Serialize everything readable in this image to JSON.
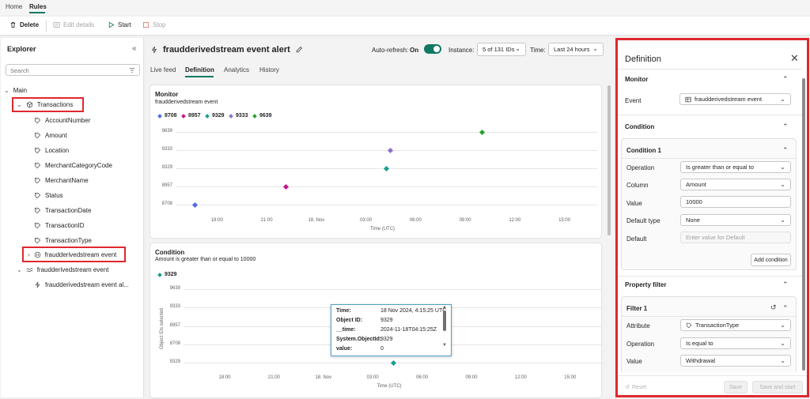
{
  "top_tabs": [
    "Home",
    "Rules"
  ],
  "toolbar": {
    "delete": "Delete",
    "edit_details": "Edit details",
    "start": "Start",
    "stop": "Stop"
  },
  "explorer": {
    "title": "Explorer",
    "search_placeholder": "Search",
    "root": "Main",
    "object": "Transactions",
    "properties": [
      "AccountNumber",
      "Amount",
      "Location",
      "MerchantCategoryCode",
      "MerchantName",
      "Status",
      "TransactionDate",
      "TransactionID",
      "TransactionType"
    ],
    "event": "fraudderivedstream event",
    "stream": "fraudderivedstream event",
    "rule": "fraudderivedstream event al..."
  },
  "rule": {
    "title": "fraudderivedstream event alert",
    "auto_refresh_label": "Auto-refresh:",
    "auto_refresh_state": "On",
    "instance_label": "Instance:",
    "instance_value": "5 of 131 IDs",
    "time_label": "Time:",
    "time_value": "Last 24 hours"
  },
  "subtabs": [
    "Live feed",
    "Definition",
    "Analytics",
    "History"
  ],
  "monitor_card": {
    "title": "Monitor",
    "subtitle": "fraudderivedstream event",
    "xlabel": "Time (UTC)"
  },
  "condition_card": {
    "title": "Condition",
    "subtitle": "Amount is greater than or equal to 10000",
    "xlabel": "Time (UTC)",
    "ylabel": "Object IDs selected"
  },
  "chart_data": [
    {
      "type": "scatter",
      "title": "Monitor",
      "subtitle": "fraudderivedstream event",
      "xlabel": "Time (UTC)",
      "x_ticks": [
        "18:00",
        "21:00",
        "18. Nov",
        "03:00",
        "06:00",
        "09:00",
        "12:00",
        "15:00"
      ],
      "y_categories": [
        "9639",
        "9333",
        "9329",
        "8957",
        "8708"
      ],
      "series": [
        {
          "name": "8708",
          "color": "#4f6bed",
          "points": [
            {
              "x": "17 Nov 16:40",
              "y": "8708"
            }
          ]
        },
        {
          "name": "8957",
          "color": "#c4168f",
          "points": [
            {
              "x": "17 Nov 22:10",
              "y": "8957"
            }
          ]
        },
        {
          "name": "9329",
          "color": "#1a9e8f",
          "points": [
            {
              "x": "18 Nov 04:15",
              "y": "9329"
            }
          ]
        },
        {
          "name": "9333",
          "color": "#8b6fd0",
          "points": [
            {
              "x": "18 Nov 04:30",
              "y": "9333"
            }
          ]
        },
        {
          "name": "9639",
          "color": "#2aa12f",
          "points": [
            {
              "x": "18 Nov 10:00",
              "y": "9639"
            }
          ]
        }
      ]
    },
    {
      "type": "scatter",
      "title": "Condition",
      "subtitle": "Amount is greater than or equal to 10000",
      "xlabel": "Time (UTC)",
      "ylabel": "Object IDs selected",
      "x_ticks": [
        "18:00",
        "21:00",
        "18. Nov",
        "03:00",
        "06:00",
        "09:00",
        "12:00",
        "15:00"
      ],
      "y_categories": [
        "9639",
        "9333",
        "8957",
        "8708",
        "9329"
      ],
      "series": [
        {
          "name": "9329",
          "color": "#1a9e8f",
          "points": [
            {
              "x": "18 Nov 04:15",
              "y": "9329"
            }
          ]
        }
      ]
    }
  ],
  "tooltip": {
    "rows": [
      {
        "k": "Time:",
        "v": "18 Nov 2024, 4:15:25 UTC"
      },
      {
        "k": "Object ID:",
        "v": "9329"
      },
      {
        "k": "__time:",
        "v": "2024-11-18T04:15:25Z"
      },
      {
        "k": "System.ObjectId:",
        "v": "9329"
      },
      {
        "k": "value:",
        "v": "0"
      }
    ]
  },
  "definition": {
    "title": "Definition",
    "monitor_section": "Monitor",
    "event_label": "Event",
    "event_value": "fraudderivedstream event",
    "condition_section": "Condition",
    "condition1": "Condition 1",
    "operation_label": "Operation",
    "operation_value": "Is greater than or equal to",
    "column_label": "Column",
    "column_value": "Amount",
    "value_label": "Value",
    "value_value": "10000",
    "default_type_label": "Default type",
    "default_type_value": "None",
    "default_label": "Default",
    "default_placeholder": "Enter value for Default",
    "add_condition": "Add condition",
    "property_filter": "Property filter",
    "filter1": "Filter 1",
    "attribute_label": "Attribute",
    "attribute_value": "TransactionType",
    "pf_operation_label": "Operation",
    "pf_operation_value": "Is equal to",
    "pf_value_label": "Value",
    "pf_value_value": "Withdrawal",
    "reset": "Reset",
    "save": "Save",
    "save_and_start": "Save and start"
  }
}
